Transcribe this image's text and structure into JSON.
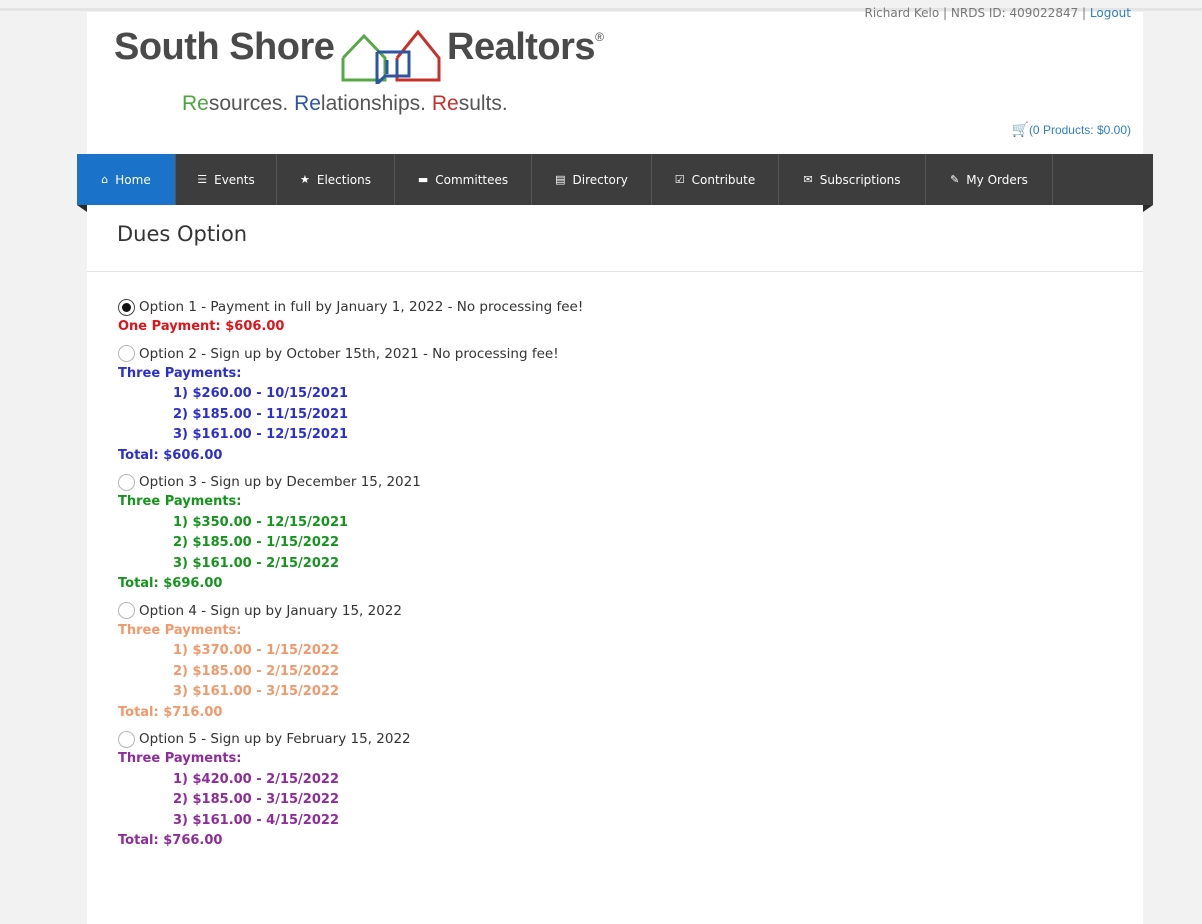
{
  "header": {
    "user_text": "Richard Kelo | NRDS ID: 409022847 | ",
    "logout": "Logout",
    "logo_left": "South Shore",
    "logo_right": "Realtors",
    "logo_reg": "®",
    "tagline": {
      "p1a": "Re",
      "p1b": "sources. ",
      "p2a": "Re",
      "p2b": "lationships. ",
      "p3a": "Re",
      "p3b": "sults."
    },
    "cart_text": "(0 Products: $0.00)"
  },
  "nav": {
    "items": [
      {
        "label": "Home",
        "icon": "home-icon"
      },
      {
        "label": "Events",
        "icon": "list-icon"
      },
      {
        "label": "Elections",
        "icon": "star-icon"
      },
      {
        "label": "Committees",
        "icon": "comment-icon"
      },
      {
        "label": "Directory",
        "icon": "table-icon"
      },
      {
        "label": "Contribute",
        "icon": "check-square-icon"
      },
      {
        "label": "Subscriptions",
        "icon": "envelope-icon"
      },
      {
        "label": "My Orders",
        "icon": "pin-icon"
      }
    ],
    "active": "Home"
  },
  "page_title": "Dues Option",
  "options": [
    {
      "label": "Option 1 - Payment in full by January 1, 2022 - No processing fee!",
      "checked": true,
      "color": "#e0131b",
      "heading": "One Payment: $606.00",
      "payments": [],
      "total": ""
    },
    {
      "label": "Option 2 - Sign up by October 15th, 2021 - No processing fee!",
      "checked": false,
      "color": "#2b2fcf",
      "heading": "Three Payments:",
      "payments": [
        "1) $260.00 - 10/15/2021",
        "2) $185.00 - 11/15/2021",
        "3) $161.00 - 12/15/2021"
      ],
      "total": "Total: $606.00"
    },
    {
      "label": "Option 3 - Sign up by December 15, 2021",
      "checked": false,
      "color": "#14951c",
      "heading": "Three Payments:",
      "payments": [
        "1) $350.00 - 12/15/2021",
        "2) $185.00 - 1/15/2022",
        "3) $161.00 - 2/15/2022"
      ],
      "total": "Total: $696.00"
    },
    {
      "label": "Option 4 - Sign up by January 15, 2022",
      "checked": false,
      "color": "#f3986a",
      "heading": "Three Payments:",
      "payments": [
        "1) $370.00 - 1/15/2022",
        "2) $185.00 - 2/15/2022",
        "3) $161.00 - 3/15/2022"
      ],
      "total": "Total: $716.00"
    },
    {
      "label": "Option 5 - Sign up by February 15, 2022",
      "checked": false,
      "color": "#8f2b9c",
      "heading": "Three Payments:",
      "payments": [
        "1) $420.00 - 2/15/2022",
        "2) $185.00 - 3/15/2022",
        "3) $161.00 - 4/15/2022"
      ],
      "total": "Total: $766.00"
    }
  ]
}
